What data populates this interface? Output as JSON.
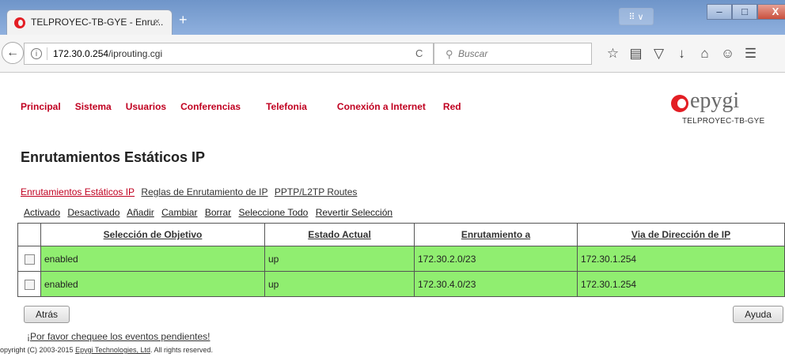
{
  "browser": {
    "tab_title": "TELPROYEC-TB-GYE - Enru...",
    "tab_close": "×",
    "new_tab": "+",
    "url_host": "172.30.0.254",
    "url_path": "/iprouting.cgi",
    "search_placeholder": "Buscar",
    "reload_glyph": "C",
    "mini_toolbar": "⠿ ∨",
    "window_buttons": {
      "minimize": "–",
      "maximize": "□",
      "close": "X"
    },
    "nav_icons": [
      "star-icon",
      "reading-list-icon",
      "pocket-icon",
      "download-icon",
      "home-icon",
      "smiley-icon",
      "menu-icon"
    ]
  },
  "menu": {
    "items": [
      "Principal",
      "Sistema",
      "Usuarios",
      "Conferencias",
      "Telefonia",
      "Conexión a Internet",
      "Red"
    ]
  },
  "logo": {
    "text": "epygi",
    "subtitle": "TELPROYEC-TB-GYE"
  },
  "page": {
    "title": "Enrutamientos Estáticos IP",
    "subtabs": [
      "Enrutamientos Estáticos IP",
      "Reglas de Enrutamiento de IP",
      "PPTP/L2TP Routes"
    ],
    "actions": [
      "Activado",
      "Desactivado",
      "Añadir",
      "Cambiar",
      "Borrar",
      "Seleccione Todo",
      "Revertir Selección"
    ]
  },
  "table": {
    "headers": [
      "Selección de Objetivo",
      "Estado Actual",
      "Enrutamiento a",
      "Via de Dirección de IP"
    ],
    "rows": [
      [
        "enabled",
        "up",
        "172.30.2.0/23",
        "172.30.1.254"
      ],
      [
        "enabled",
        "up",
        "172.30.4.0/23",
        "172.30.1.254"
      ]
    ]
  },
  "buttons": {
    "back": "Atrás",
    "help": "Ayuda"
  },
  "notice": "¡Por favor chequee los eventos pendientes!",
  "footer": {
    "prefix": "opyright (C) 2003-2015 ",
    "company": "Epygi Technologies, Ltd",
    "suffix": ". All rights reserved."
  },
  "colors": {
    "accent_red": "#c00020",
    "row_green": "#90ee70",
    "logo_red": "#e31e24"
  }
}
